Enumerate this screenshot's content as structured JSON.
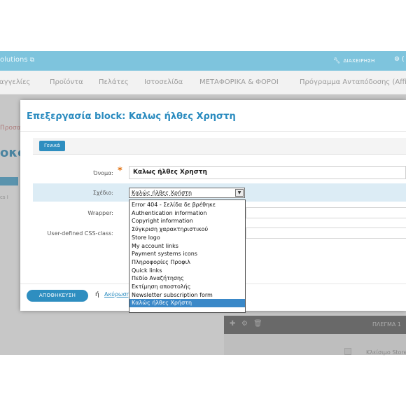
{
  "topbar": {
    "brand": "olutions",
    "brand_ext_icon": "external-link-icon",
    "maintenance_label": "ΔΙΑΧΕΙΡΗΣΗ",
    "maintenance_icon": "wrench-icon",
    "more_icon": "gear-icon",
    "more_label": "(",
    "bg_color": "#7ec4dd"
  },
  "nav": {
    "items": [
      "αγγελίες",
      "Προϊόντα",
      "Πελάτες",
      "Ιστοσελίδα",
      "ΜΕΤΑΦΟΡΙΚΑ & ΦΟΡΟΙ",
      "Πρόγραμμα Ανταπόδοσης (Affil"
    ]
  },
  "background": {
    "red_text": "Προσα",
    "title_fragment": "οκς",
    "cs_text": "cs   I",
    "panel_label": "ΠΛΕΓΜΑ 1",
    "row_text": "Κλείσιμο Store"
  },
  "modal": {
    "title": "Επεξεργασία block: Καλως ήλθες Χρηστη",
    "tab_general": "Γενικά",
    "name_label": "Όνομα:",
    "name_value": "Καλως ήλθες Χρηστη",
    "required_mark": "*",
    "design_label": "Σχέδιο:",
    "design_value": "Καλώς ήλθες Χρήστη",
    "wrapper_label": "Wrapper:",
    "css_label": "User-defined CSS-class:",
    "design_options": [
      "Error 404 - Σελίδα δε βρέθηκε",
      "Authentication information",
      "Copyright information",
      "Σύγκριση χαρακτηριστικού",
      "Store logo",
      "My account links",
      "Payment systems icons",
      "Πληροφορίες Προφιλ",
      "Quick links",
      "Πεδίο Αναζήτησης",
      "Εκτίμηση αποστολής",
      "Newsletter subscription form",
      "Καλώς ήλθες Χρήστη"
    ],
    "selected_index": 12,
    "save_label": "ΑΠΟΘΗΚΕΥΣΗ",
    "or_label": "ή",
    "cancel_label": "Ακύρωση"
  },
  "colors": {
    "accent": "#2e8ec0",
    "title": "#2a8bbf",
    "highlight_row": "#dcecf5",
    "selected_option": "#3a88c8"
  }
}
